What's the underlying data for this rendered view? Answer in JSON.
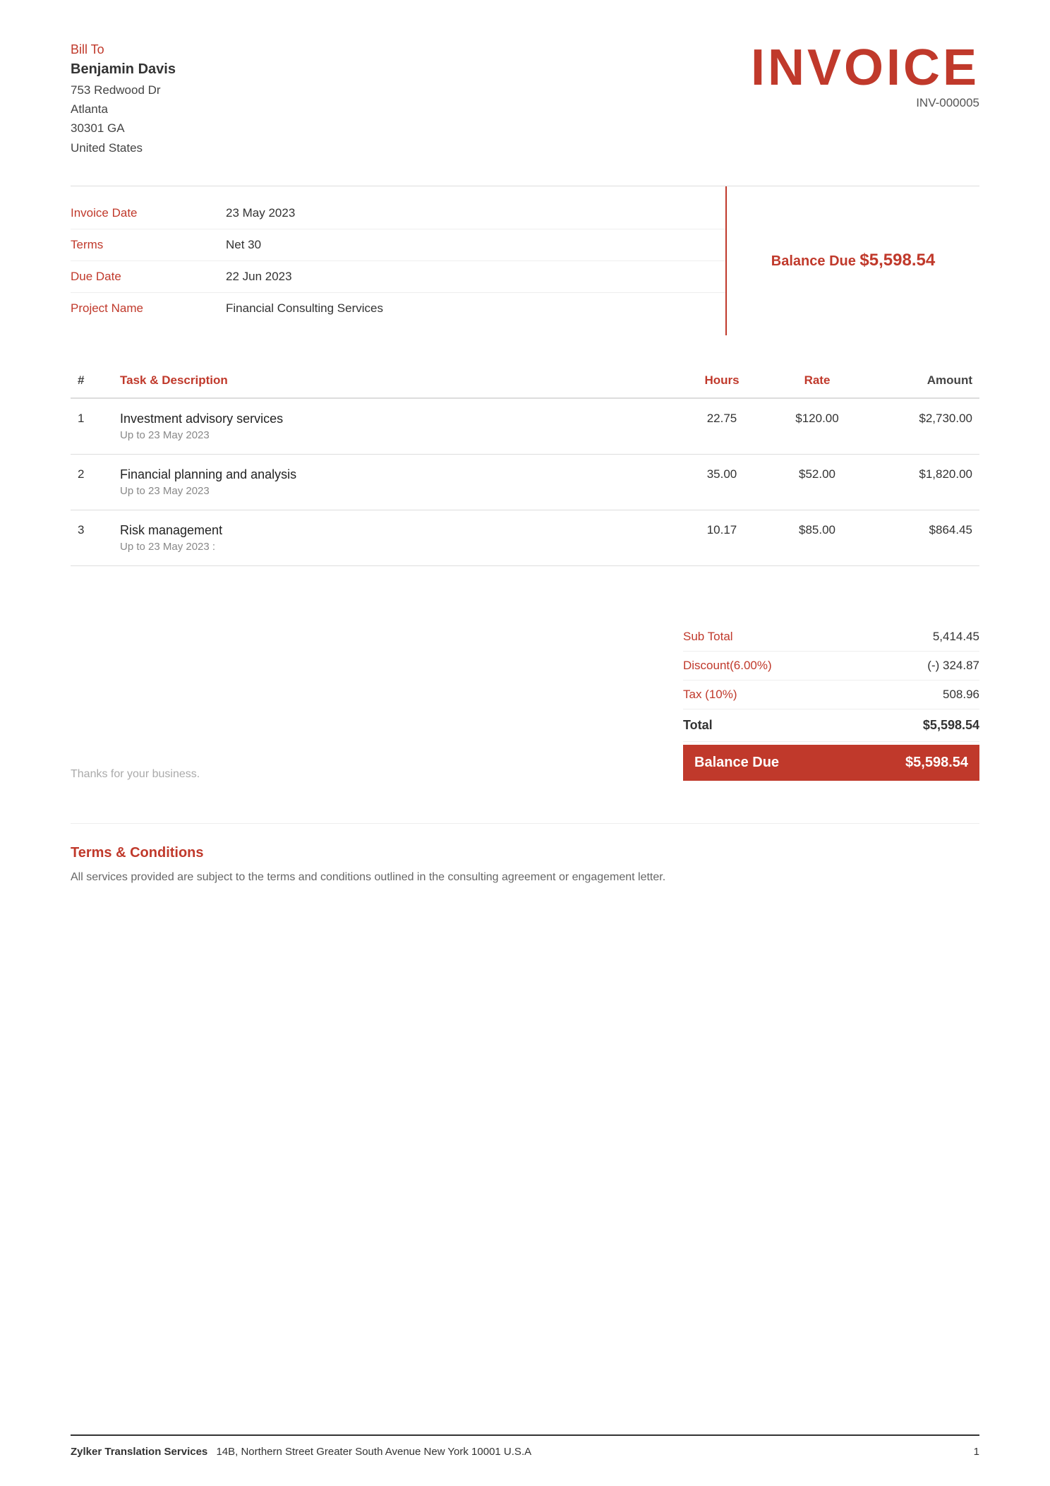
{
  "bill_to": {
    "label": "Bill To",
    "name": "Benjamin Davis",
    "address_line1": "753 Redwood Dr",
    "address_line2": "Atlanta",
    "address_line3": "30301 GA",
    "address_line4": "United States"
  },
  "invoice": {
    "title": "INVOICE",
    "number": "INV-000005"
  },
  "info": {
    "invoice_date_label": "Invoice Date",
    "invoice_date_value": "23 May 2023",
    "terms_label": "Terms",
    "terms_value": "Net 30",
    "due_date_label": "Due Date",
    "due_date_value": "22 Jun 2023",
    "project_name_label": "Project Name",
    "project_name_value": "Financial Consulting Services"
  },
  "balance_due": {
    "label": "Balance Due",
    "amount": "$5,598.54"
  },
  "table": {
    "col_hash": "#",
    "col_task": "Task & Description",
    "col_hours": "Hours",
    "col_rate": "Rate",
    "col_amount": "Amount",
    "rows": [
      {
        "num": "1",
        "task_main": "Investment advisory services",
        "task_sub": "Up to 23 May 2023",
        "hours": "22.75",
        "rate": "$120.00",
        "amount": "$2,730.00"
      },
      {
        "num": "2",
        "task_main": "Financial planning and analysis",
        "task_sub": "Up to 23 May 2023",
        "hours": "35.00",
        "rate": "$52.00",
        "amount": "$1,820.00"
      },
      {
        "num": "3",
        "task_main": "Risk management",
        "task_sub": "Up to 23 May 2023 :",
        "hours": "10.17",
        "rate": "$85.00",
        "amount": "$864.45"
      }
    ]
  },
  "notes": {
    "text": "Thanks for your business."
  },
  "totals": {
    "sub_total_label": "Sub Total",
    "sub_total_value": "5,414.45",
    "discount_label": "Discount(6.00%)",
    "discount_value": "(-) 324.87",
    "tax_label": "Tax (10%)",
    "tax_value": "508.96",
    "total_label": "Total",
    "total_value": "$5,598.54",
    "balance_due_label": "Balance Due",
    "balance_due_value": "$5,598.54"
  },
  "terms": {
    "title": "Terms & Conditions",
    "text": "All services provided are subject to the terms and conditions outlined in the consulting agreement or engagement letter."
  },
  "footer": {
    "company": "Zylker Translation Services",
    "address": "14B, Northern Street Greater South Avenue New York 10001 U.S.A",
    "page": "1"
  }
}
